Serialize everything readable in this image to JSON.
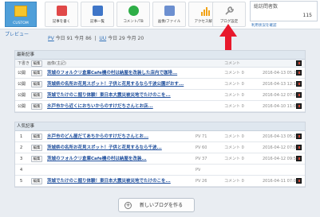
{
  "preview": {
    "tile_text": "CUSTOM",
    "label": "プレビュー"
  },
  "toolbar": [
    {
      "label": "記事を書く",
      "icon": "pencil-icon",
      "color": "#e04848"
    },
    {
      "label": "記事一覧",
      "icon": "list-icon",
      "color": "#3f76c8"
    },
    {
      "label": "コメント/TB",
      "icon": "speech-bubble-icon",
      "color": "#2eae47"
    },
    {
      "label": "画像/ファイル",
      "icon": "image-icon",
      "color": "#6c8fd0"
    },
    {
      "label": "アクセス解析",
      "icon": "bar-chart-icon",
      "color": "#f2a318"
    },
    {
      "label": "ブログ設定",
      "icon": "wrench-icon",
      "color": "#8e8e8e"
    }
  ],
  "stats": {
    "title": "総訪問者数",
    "value": "115",
    "link": "利用状況を確認"
  },
  "counts": [
    {
      "key": "PV",
      "period": "今日",
      "value": "91",
      "period2": "今月",
      "value2": "86"
    },
    {
      "key": "UU",
      "period": "今日",
      "value": "29",
      "period2": "今月",
      "value2": "20"
    }
  ],
  "recent": {
    "title": "最新記事",
    "header": {
      "status": "下書き",
      "edit": "編集",
      "title": "画像(主記)",
      "comment": "コメント",
      "date": ""
    },
    "rows": [
      {
        "status": "公開",
        "edit": "編集",
        "title": "茨城のフォルクリ倉庫Cafe機の村は納屋を改装した店内で珈琲...",
        "comment": "コメント 0",
        "date": "2016-04-13 05:21"
      },
      {
        "status": "公開",
        "edit": "編集",
        "title": "茨城県の名所お花見スポット！子供と花見するなら千波公園がおす...",
        "comment": "コメント 0",
        "date": "2016-04-13 12:14"
      },
      {
        "status": "公開",
        "edit": "編集",
        "title": "茨城でたけのこ掘り体験！東日本大震災被災地でたけのこを...",
        "comment": "コメント 0",
        "date": "2016-04-12 07:00"
      },
      {
        "status": "公開",
        "edit": "編集",
        "title": "水戸市から近くにおちいからのすけだちさんとお店...",
        "comment": "コメント 0",
        "date": "2016-04-10 11:03"
      }
    ]
  },
  "popular": {
    "title": "人気記事",
    "rows": [
      {
        "rank": "1",
        "edit": "編集",
        "title": "水戸市のどん屋だてあちからのすけだちさんとお...",
        "pv": "PV 71",
        "comment": "コメント 0",
        "date": "2016-04-13 05:21"
      },
      {
        "rank": "2",
        "edit": "編集",
        "title": "茨城県の名所お花見スポット！子供と花見するなら千波...",
        "pv": "PV 60",
        "comment": "コメント 0",
        "date": "2016-04-12 07:00"
      },
      {
        "rank": "3",
        "edit": "編集",
        "title": "茨城のフォルクリ倉庫Cafe機の村は納屋を改装...",
        "pv": "PV 37",
        "comment": "コメント 0",
        "date": "2016-04-12 09:52"
      },
      {
        "rank": "4",
        "edit": "",
        "title": "",
        "pv": "PV",
        "comment": "",
        "date": ""
      },
      {
        "rank": "5",
        "edit": "編集",
        "title": "茨城でたけのこ掘り体験！東日本大震災被災地でたけのこを...",
        "pv": "PV 26",
        "comment": "コメント 0",
        "date": "2016-04-11 07:00"
      }
    ]
  },
  "new_blog": {
    "label": "新しいブログを作る"
  }
}
